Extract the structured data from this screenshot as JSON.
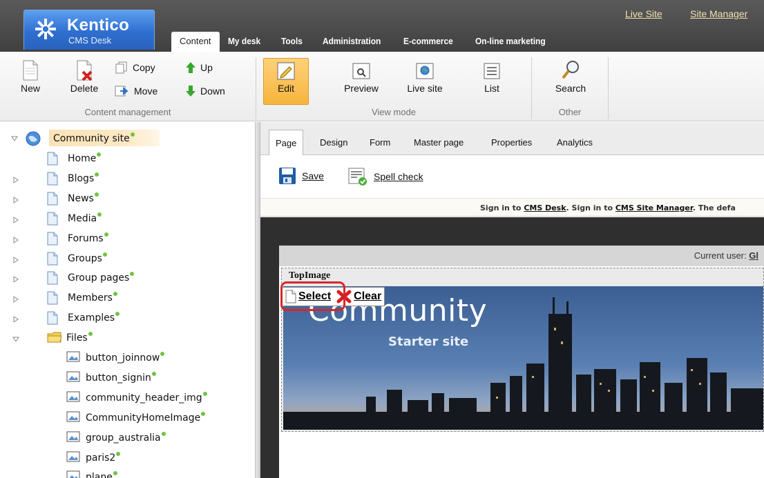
{
  "header": {
    "logo_name": "Kentico",
    "logo_sub": "CMS Desk",
    "links": [
      "Live Site",
      "Site Manager"
    ],
    "tabs": [
      "Content",
      "My desk",
      "Tools",
      "Administration",
      "E-commerce",
      "On-line marketing"
    ],
    "active_tab": "Content"
  },
  "ribbon": {
    "content_management": {
      "label": "Content management",
      "new": "New",
      "delete": "Delete",
      "copy": "Copy",
      "move": "Move",
      "up": "Up",
      "down": "Down"
    },
    "view_mode": {
      "label": "View mode",
      "edit": "Edit",
      "preview": "Preview",
      "live_site": "Live site",
      "list": "List"
    },
    "other": {
      "label": "Other",
      "search": "Search"
    }
  },
  "tree": {
    "root": "Community site",
    "items": [
      "Home",
      "Blogs",
      "News",
      "Media",
      "Forums",
      "Groups",
      "Group pages",
      "Members",
      "Examples",
      "Files"
    ],
    "files": [
      "button_joinnow",
      "button_signin",
      "community_header_img",
      "CommunityHomeImage",
      "group_australia",
      "paris2",
      "plane"
    ]
  },
  "content": {
    "tabs": [
      "Page",
      "Design",
      "Form",
      "Master page",
      "Properties",
      "Analytics"
    ],
    "active_tab": "Page",
    "actions": {
      "save": "Save",
      "spell_check": "Spell check"
    },
    "signbar": {
      "t1": "Sign in to ",
      "l1": "CMS Desk",
      "t2": ". Sign in to ",
      "l2": "CMS Site Manager",
      "t3": ". The defa"
    },
    "current_user": "Current user:",
    "current_user_value": "Gl",
    "zone_title": "TopImage",
    "select": "Select",
    "clear": "Clear",
    "banner_title": "Community",
    "banner_sub": "Starter site"
  },
  "colors": {
    "accent_blue": "#2f6fd0",
    "active_orange": "#f7b43c",
    "status_green": "#71c343",
    "highlight_red": "#d8262b"
  }
}
